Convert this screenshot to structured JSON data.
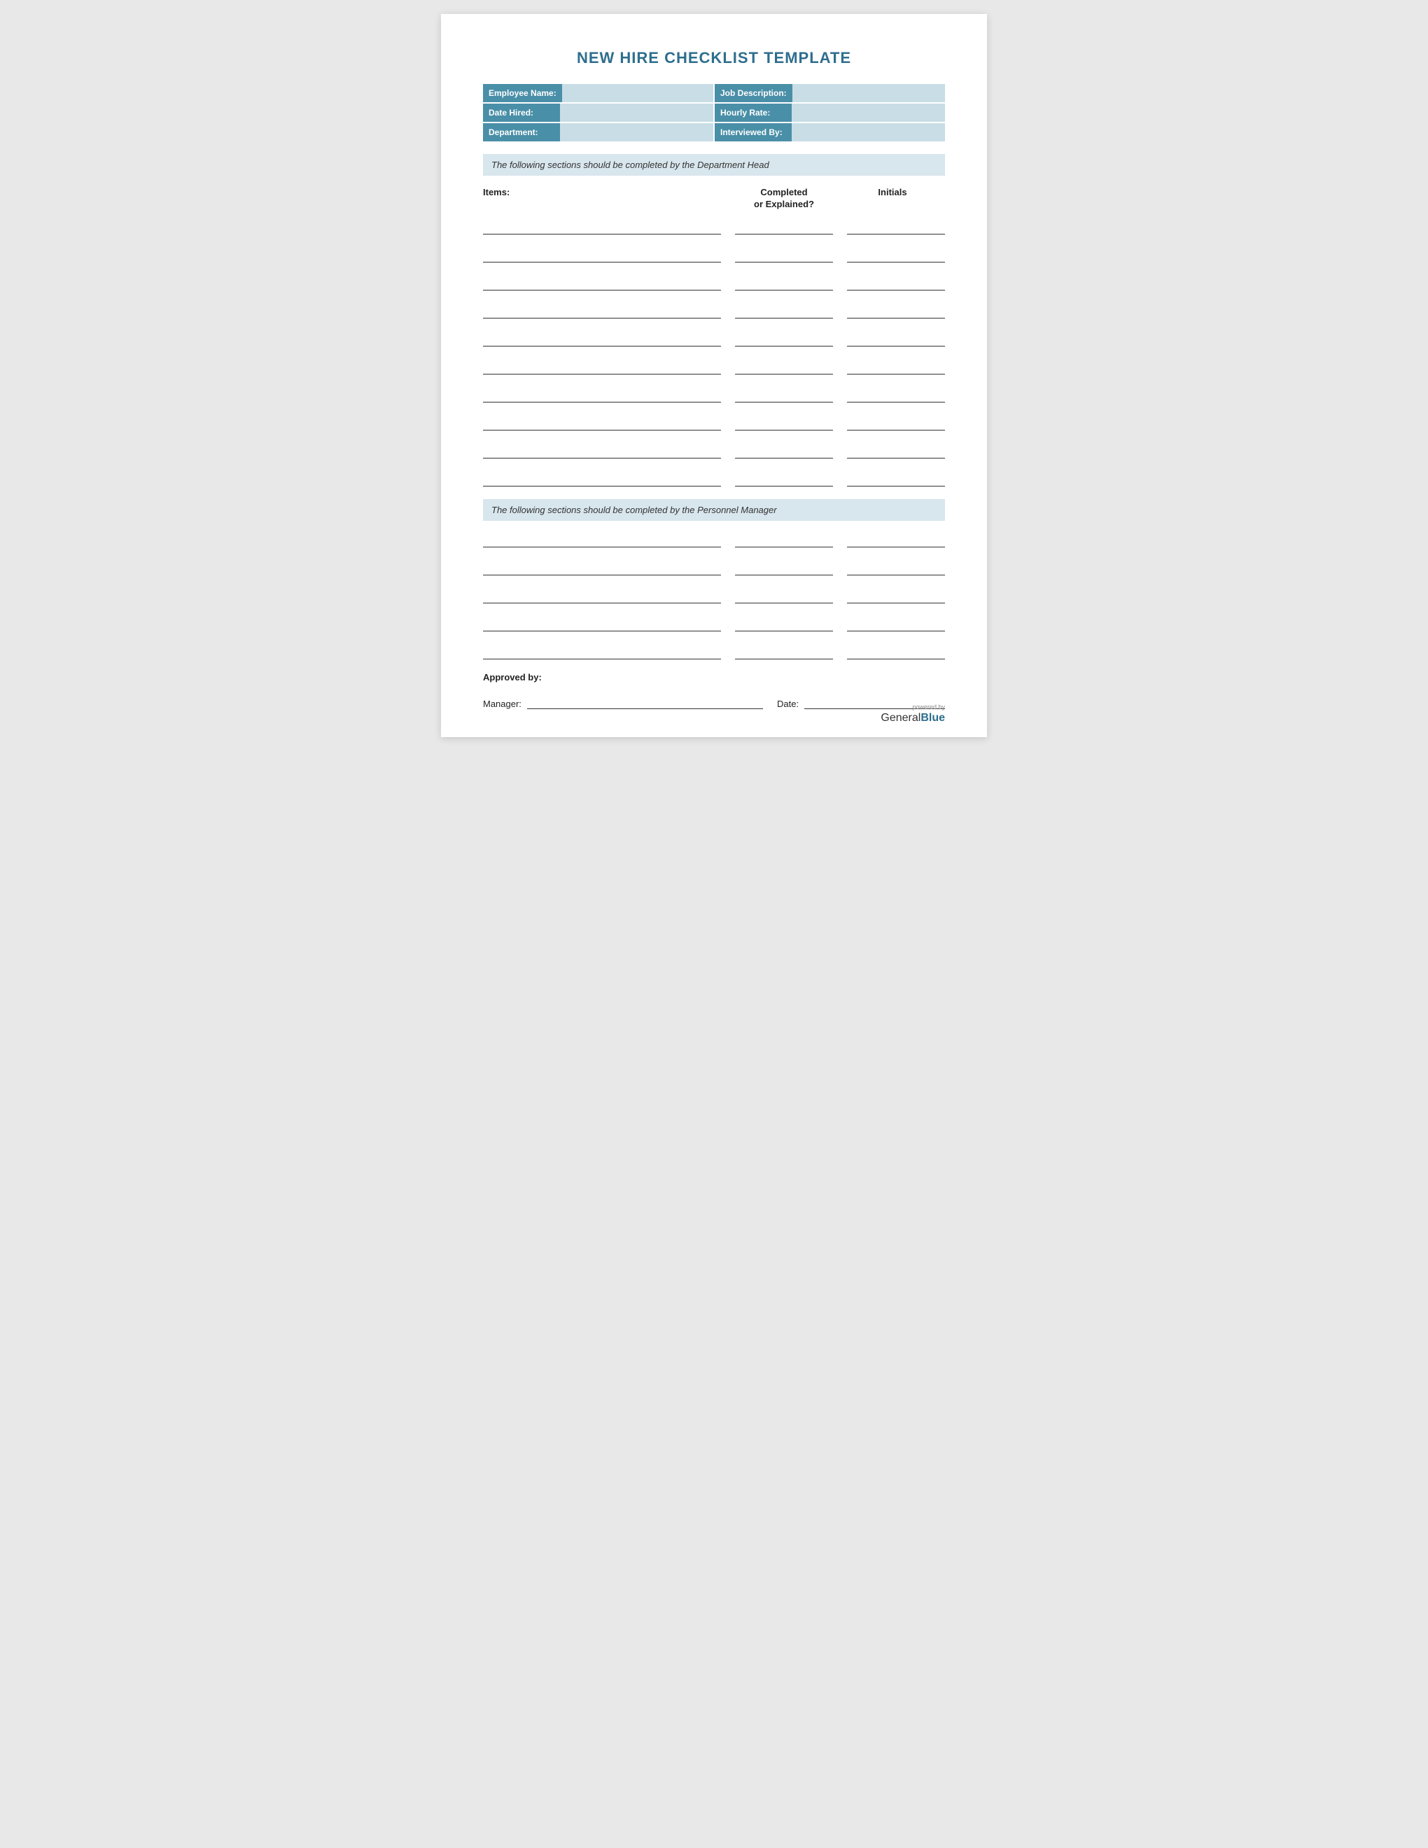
{
  "page": {
    "title": "NEW HIRE CHECKLIST TEMPLATE"
  },
  "header_fields": {
    "left": [
      {
        "label": "Employee Name:",
        "id": "employee-name"
      },
      {
        "label": "Date Hired:",
        "id": "date-hired"
      },
      {
        "label": "Department:",
        "id": "department"
      }
    ],
    "right": [
      {
        "label": "Job Description:",
        "id": "job-description"
      },
      {
        "label": "Hourly Rate:",
        "id": "hourly-rate"
      },
      {
        "label": "Interviewed By:",
        "id": "interviewed-by"
      }
    ]
  },
  "sections": [
    {
      "id": "department-head-section",
      "banner": "The following sections should be completed by the Department Head",
      "columns": {
        "items": "Items:",
        "completed": "Completed\nor Explained?",
        "initials": "Initials"
      },
      "rows": 10,
      "has_header": true
    },
    {
      "id": "personnel-manager-section",
      "banner": "The following sections should be completed by the Personnel Manager",
      "rows": 5,
      "has_header": false
    }
  ],
  "approved": {
    "title": "Approved by:",
    "manager_label": "Manager:",
    "date_label": "Date:"
  },
  "footer": {
    "powered_by": "powered by",
    "brand_regular": "General",
    "brand_bold": "Blue"
  }
}
